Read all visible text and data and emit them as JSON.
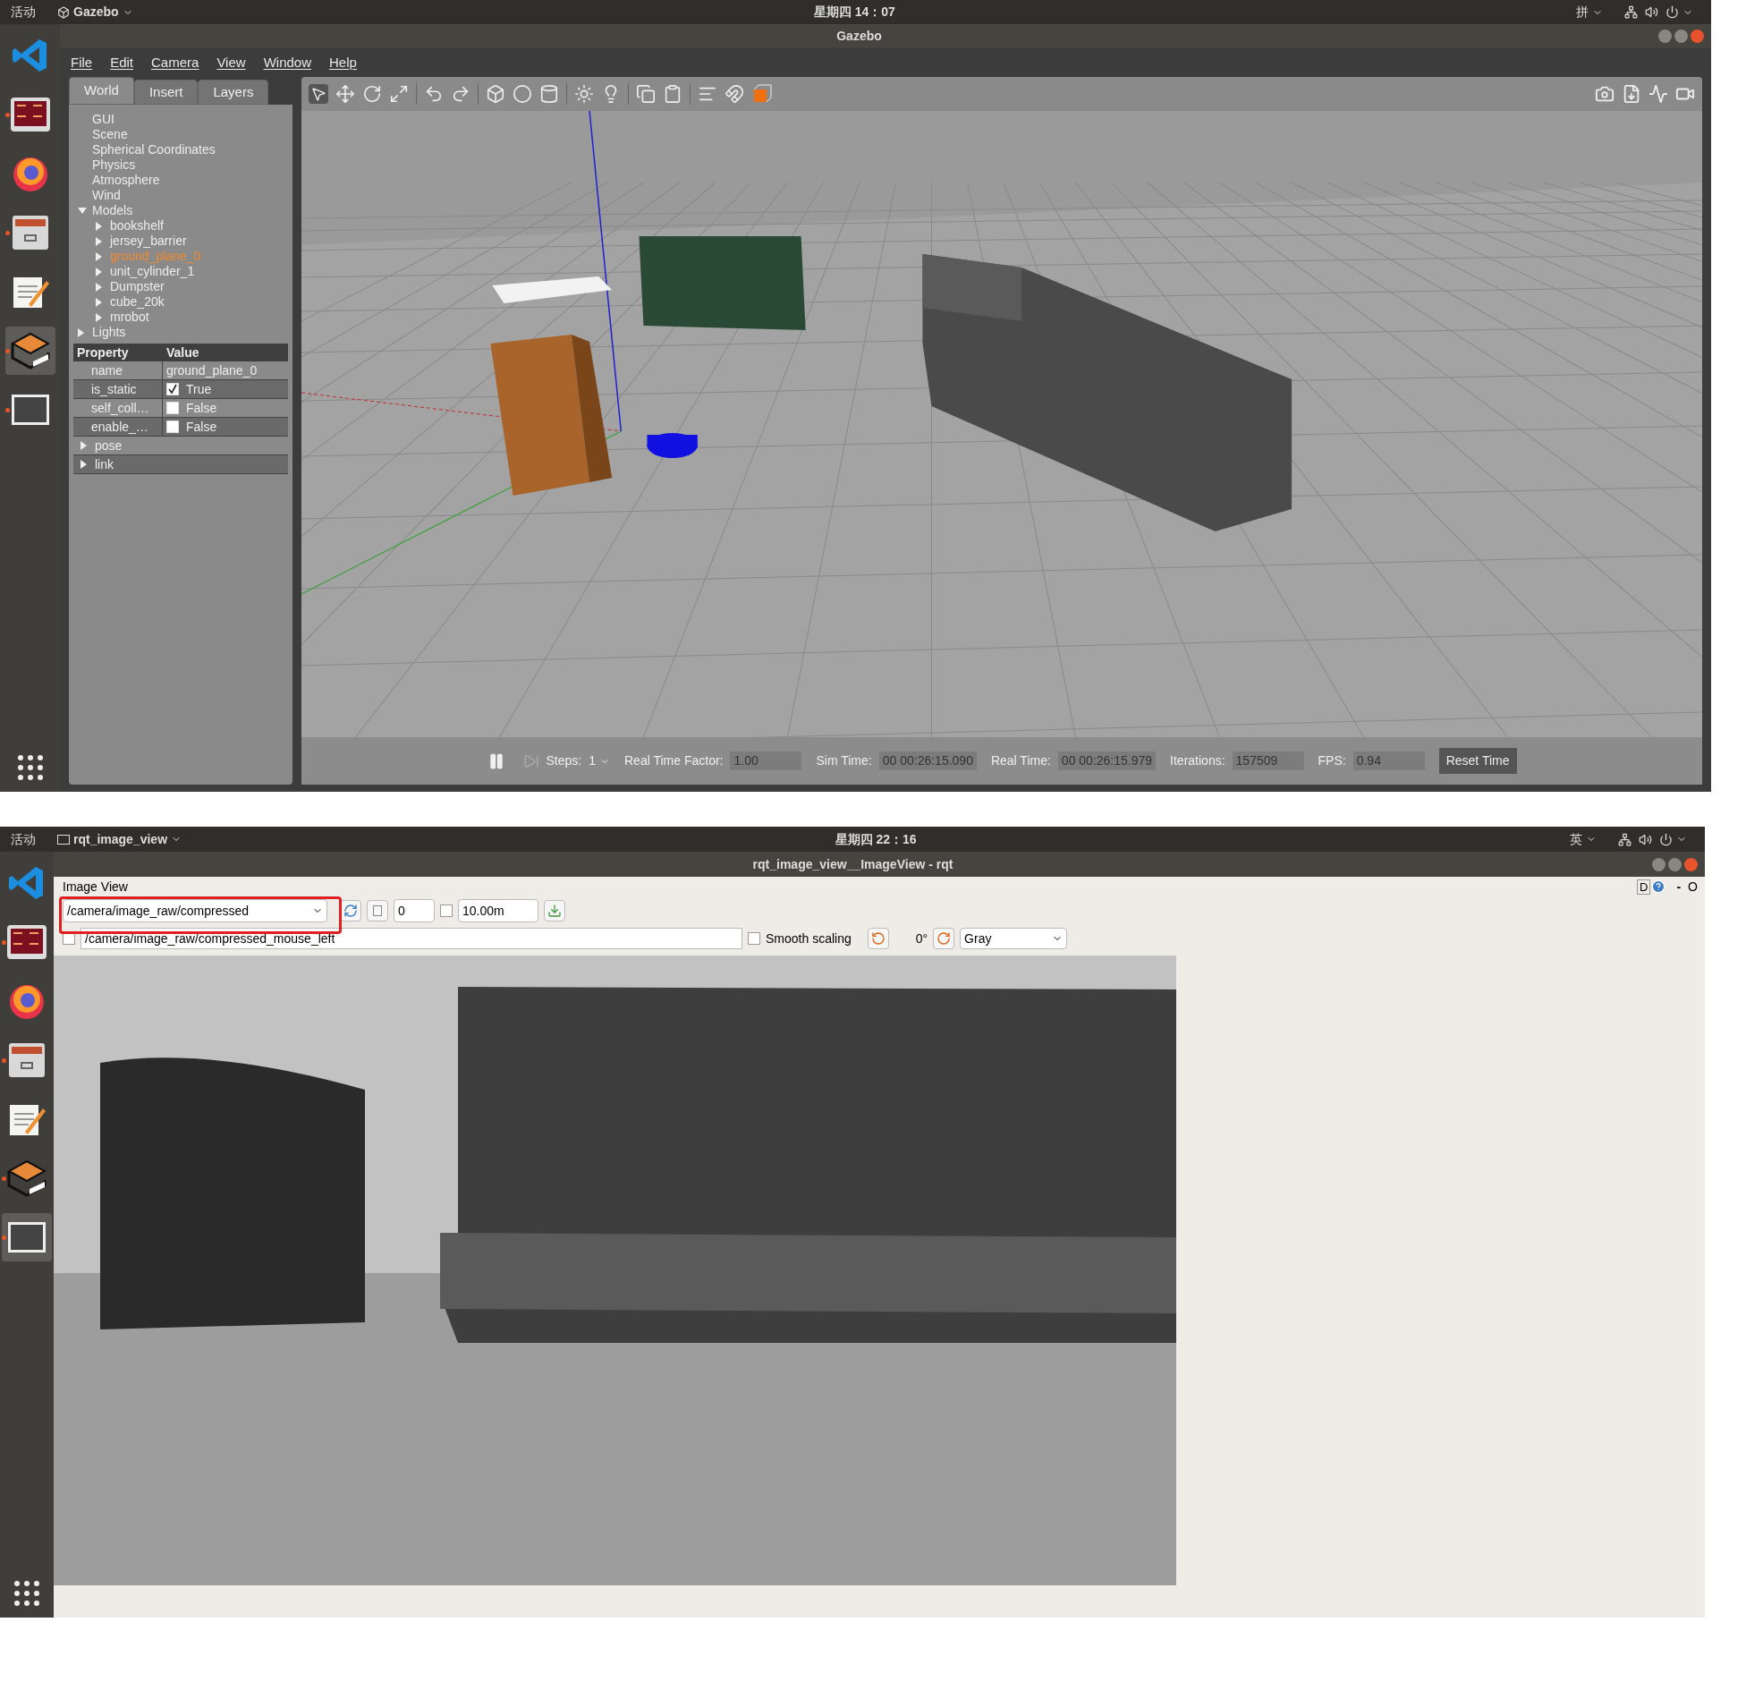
{
  "gazebo_screen": {
    "top_bar": {
      "activities": "活动",
      "app": "Gazebo",
      "clock": "星期四 14：07",
      "input_method": "拼"
    },
    "dock": [
      {
        "kind": "vscode",
        "running": false,
        "selected": false
      },
      {
        "kind": "terminal",
        "running": true,
        "selected": false
      },
      {
        "kind": "firefox",
        "running": false,
        "selected": false
      },
      {
        "kind": "files",
        "running": true,
        "selected": false
      },
      {
        "kind": "editor",
        "running": false,
        "selected": false
      },
      {
        "kind": "gazebo",
        "running": true,
        "selected": true
      },
      {
        "kind": "screen",
        "running": true,
        "selected": false
      }
    ],
    "window_title": "Gazebo",
    "menu": [
      "File",
      "Edit",
      "Camera",
      "View",
      "Window",
      "Help"
    ],
    "tabs": [
      {
        "label": "World",
        "selected": true
      },
      {
        "label": "Insert",
        "selected": false
      },
      {
        "label": "Layers",
        "selected": false
      }
    ],
    "tree": [
      {
        "label": "GUI",
        "selected": false
      },
      {
        "label": "Scene",
        "selected": false
      },
      {
        "label": "Spherical Coordinates",
        "selected": false
      },
      {
        "label": "Physics",
        "selected": false
      },
      {
        "label": "Atmosphere",
        "selected": false
      },
      {
        "label": "Wind",
        "selected": false
      },
      {
        "label": "Models",
        "selected": false,
        "expanded": true,
        "children": [
          {
            "label": "bookshelf",
            "selected": false,
            "expanded": false
          },
          {
            "label": "jersey_barrier",
            "selected": false,
            "expanded": false
          },
          {
            "label": "ground_plane_0",
            "selected": true,
            "expanded": false
          },
          {
            "label": "unit_cylinder_1",
            "selected": false,
            "expanded": false
          },
          {
            "label": "Dumpster",
            "selected": false,
            "expanded": false
          },
          {
            "label": "cube_20k",
            "selected": false,
            "expanded": false
          },
          {
            "label": "mrobot",
            "selected": false,
            "expanded": false
          }
        ]
      },
      {
        "label": "Lights",
        "selected": false,
        "expanded": false
      }
    ],
    "properties": {
      "columns": [
        "Property",
        "Value"
      ],
      "rows": [
        {
          "kind": "text",
          "name": "name",
          "value": "ground_plane_0"
        },
        {
          "kind": "bool",
          "name": "is_static",
          "value": "True",
          "checked": true
        },
        {
          "kind": "bool",
          "name": "self_coll…",
          "value": "False",
          "checked": false
        },
        {
          "kind": "bool",
          "name": "enable_…",
          "value": "False",
          "checked": false
        }
      ],
      "groups": [
        {
          "label": "pose",
          "expanded": false
        },
        {
          "label": "link",
          "expanded": false
        }
      ]
    },
    "status_bar": {
      "steps_label": "Steps:",
      "steps": "1",
      "fields": [
        {
          "label": "Real Time Factor:",
          "value": "1.00"
        },
        {
          "label": "Sim Time:",
          "value": "00 00:26:15.090"
        },
        {
          "label": "Real Time:",
          "value": "00 00:26:15.979"
        },
        {
          "label": "Iterations:",
          "value": "157509"
        },
        {
          "label": "FPS:",
          "value": "0.94"
        }
      ],
      "reset_button": "Reset Time"
    }
  },
  "rqt_screen": {
    "top_bar": {
      "activities": "活动",
      "app": "rqt_image_view",
      "clock": "星期四 22：16",
      "input_method": "英"
    },
    "dock": [
      {
        "kind": "vscode",
        "running": false,
        "selected": false
      },
      {
        "kind": "terminal",
        "running": true,
        "selected": false
      },
      {
        "kind": "firefox",
        "running": false,
        "selected": false
      },
      {
        "kind": "files",
        "running": true,
        "selected": false
      },
      {
        "kind": "editor",
        "running": false,
        "selected": false
      },
      {
        "kind": "gazebo",
        "running": true,
        "selected": false
      },
      {
        "kind": "screen",
        "running": true,
        "selected": true
      }
    ],
    "window_title": "rqt_image_view__ImageView - rqt",
    "plugin_title": "Image View",
    "dock_buttons": [
      "D",
      "-",
      "O"
    ],
    "topic": "/camera/image_raw/compressed",
    "spin_value": "0",
    "timeout_checked": false,
    "timeout_value": "10.00m",
    "mouse_checked": false,
    "mouse_topic": "/camera/image_raw/compressed_mouse_left",
    "smooth_scaling": {
      "label": "Smooth scaling",
      "checked": false
    },
    "rotation": "0°",
    "color_scheme": "Gray"
  }
}
